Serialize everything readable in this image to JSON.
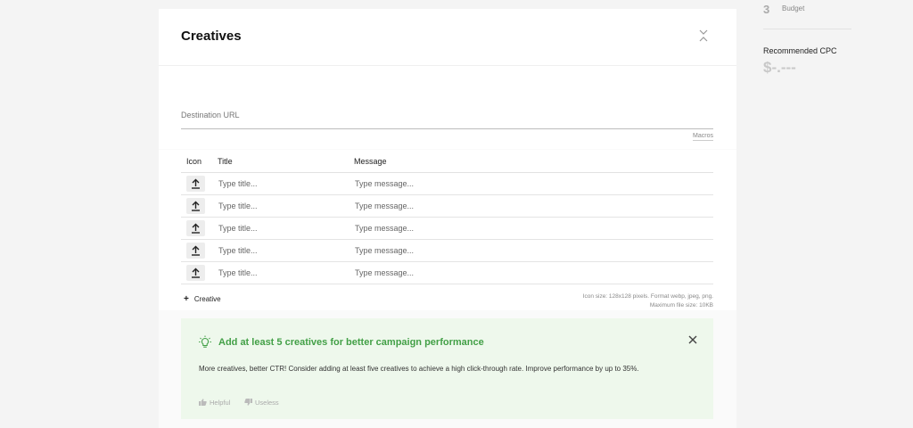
{
  "panel": {
    "title": "Creatives"
  },
  "destination_url": {
    "placeholder": "Destination URL",
    "value": "",
    "macros_label": "Macros"
  },
  "creatives_table": {
    "headers": {
      "icon": "Icon",
      "title": "Title",
      "message": "Message"
    },
    "rows": [
      {
        "title_placeholder": "Type title...",
        "message_placeholder": "Type message..."
      },
      {
        "title_placeholder": "Type title...",
        "message_placeholder": "Type message..."
      },
      {
        "title_placeholder": "Type title...",
        "message_placeholder": "Type message..."
      },
      {
        "title_placeholder": "Type title...",
        "message_placeholder": "Type message..."
      },
      {
        "title_placeholder": "Type title...",
        "message_placeholder": "Type message..."
      }
    ],
    "add_label": "Creative",
    "hint_line1": "Icon size: 128x128 pixels. Format webp, jpeg, png.",
    "hint_line2": "Maximum file size: 10KB"
  },
  "tip": {
    "heading": "Add at least 5 creatives for better campaign performance",
    "body": "More creatives, better CTR! Consider adding at least five creatives to achieve a high click-through rate. Improve performance by up to 35%.",
    "helpful_label": "Helpful",
    "useless_label": "Useless",
    "accent_color": "#43a047",
    "background_color": "#eef8ec"
  },
  "sidebar": {
    "step_number": "3",
    "step_label": "Budget",
    "cpc_label": "Recommended CPC",
    "cpc_value": "$-.---"
  },
  "icons": {
    "collapse": "chevrons-collapse-icon",
    "upload": "upload-arrow-icon",
    "add": "plus-icon",
    "tip": "lightbulb-icon",
    "close": "close-icon",
    "helpful": "thumbs-up-icon",
    "useless": "thumbs-down-icon"
  }
}
